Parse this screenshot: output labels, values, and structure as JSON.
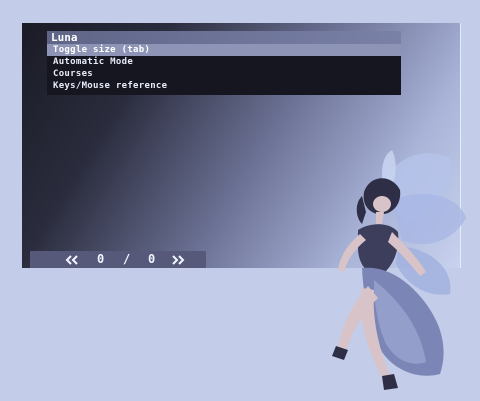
{
  "menu": {
    "title": "Luna",
    "items": [
      {
        "label": "Toggle size (tab)",
        "selected": true
      },
      {
        "label": "Automatic Mode",
        "selected": false
      },
      {
        "label": "Courses",
        "selected": false
      },
      {
        "label": "Keys/Mouse reference",
        "selected": false
      }
    ]
  },
  "pager": {
    "current": "0",
    "separator": "/",
    "total": "0",
    "prev_icon": "double-chevron-left-icon",
    "next_icon": "double-chevron-right-icon"
  },
  "colors": {
    "background": "#c3cce9",
    "menu_background": "#151620",
    "menu_highlight": "#8d94b6",
    "pager_background": "#56597a"
  }
}
